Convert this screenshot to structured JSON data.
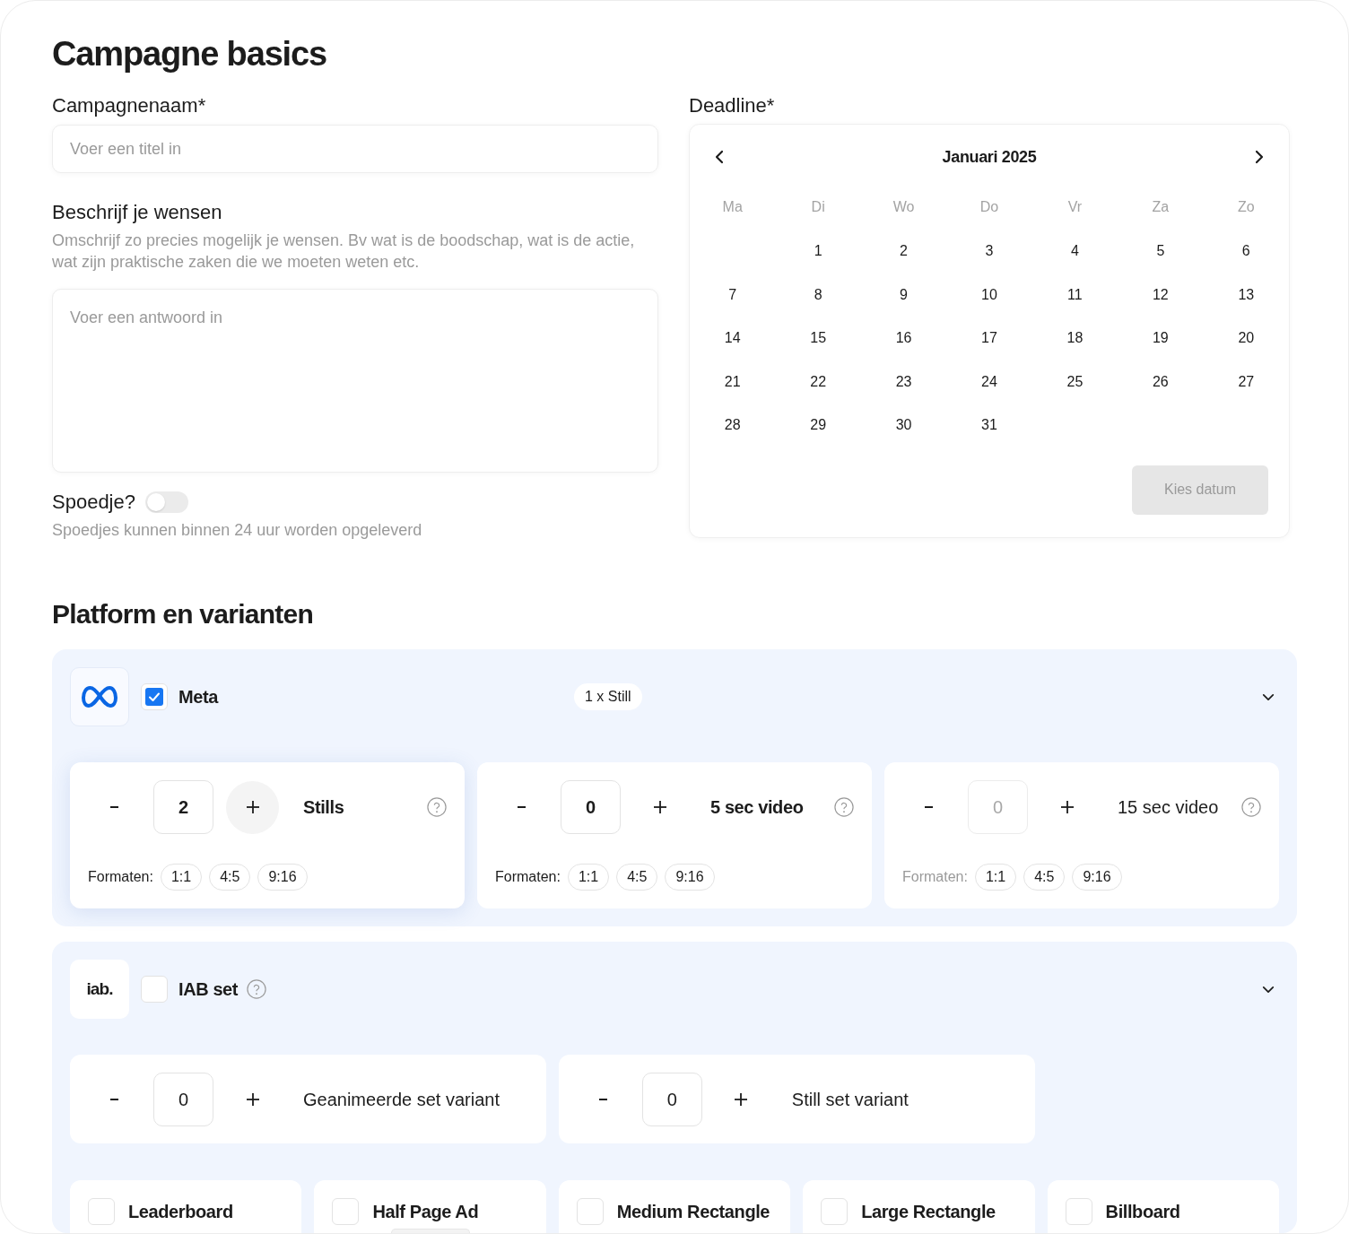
{
  "basics": {
    "title": "Campagne basics",
    "name_field": {
      "label": "Campagnenaam*",
      "placeholder": "Voer een titel in"
    },
    "wishes_field": {
      "label": "Beschrijf je wensen",
      "help": "Omschrijf zo precies mogelijk je wensen. Bv wat is de boodschap, wat is de actie, wat zijn praktische zaken die we moeten weten etc.",
      "placeholder": "Voer een antwoord in"
    },
    "rush": {
      "label": "Spoedje?",
      "on": false,
      "help": "Spoedjes kunnen binnen 24 uur worden opgeleverd"
    },
    "deadline": {
      "label": "Deadline*",
      "month": "Januari 2025",
      "weekdays": [
        "Ma",
        "Di",
        "Wo",
        "Do",
        "Vr",
        "Za",
        "Zo"
      ],
      "weeks": [
        [
          "1",
          "2",
          "3",
          "4",
          "5",
          "6"
        ],
        [
          "7",
          "8",
          "9",
          "10",
          "11",
          "12",
          "13"
        ],
        [
          "14",
          "15",
          "16",
          "17",
          "18",
          "19",
          "20"
        ],
        [
          "21",
          "22",
          "23",
          "24",
          "25",
          "26",
          "27"
        ],
        [
          "28",
          "29",
          "30",
          "31"
        ]
      ],
      "button": {
        "label": "Kies datum",
        "disabled": true
      }
    }
  },
  "platforms": {
    "title": "Platform en varianten",
    "items": [
      {
        "logo": {
          "kind": "meta"
        },
        "name": "Meta",
        "checked": true,
        "help": false,
        "badge": "1 x Still",
        "expanded": true,
        "variants": [
          {
            "kind": "formats",
            "count": "2",
            "label": "Stills",
            "active": true,
            "disabled": false,
            "formats_label": "Formaten:",
            "formats": [
              "1:1",
              "4:5",
              "9:16"
            ]
          },
          {
            "kind": "formats",
            "count": "0",
            "label": "5 sec video",
            "active": false,
            "disabled": false,
            "formats_label": "Formaten:",
            "formats": [
              "1:1",
              "4:5",
              "9:16"
            ]
          },
          {
            "kind": "formats",
            "count": "0",
            "label": "15 sec video",
            "active": false,
            "disabled": true,
            "formats_label": "Formaten:",
            "formats": [
              "1:1",
              "4:5",
              "9:16"
            ]
          }
        ]
      },
      {
        "logo": {
          "kind": "text",
          "text": "iab."
        },
        "name": "IAB set",
        "checked": false,
        "help": true,
        "expanded": true,
        "variants": [
          {
            "kind": "counter",
            "count": "0",
            "label": "Geanimeerde set variant",
            "active": false,
            "disabled": false
          },
          {
            "kind": "counter",
            "count": "0",
            "label": "Still set variant",
            "active": false,
            "disabled": false
          }
        ],
        "sizes": [
          {
            "label": "Leaderboard",
            "checked": false,
            "preview": false
          },
          {
            "label": "Half Page Ad",
            "checked": false,
            "preview": true
          },
          {
            "label": "Medium Rectangle",
            "checked": false,
            "preview": false
          },
          {
            "label": "Large Rectangle",
            "checked": false,
            "preview": false
          },
          {
            "label": "Billboard",
            "checked": false,
            "preview": false
          }
        ]
      }
    ]
  }
}
